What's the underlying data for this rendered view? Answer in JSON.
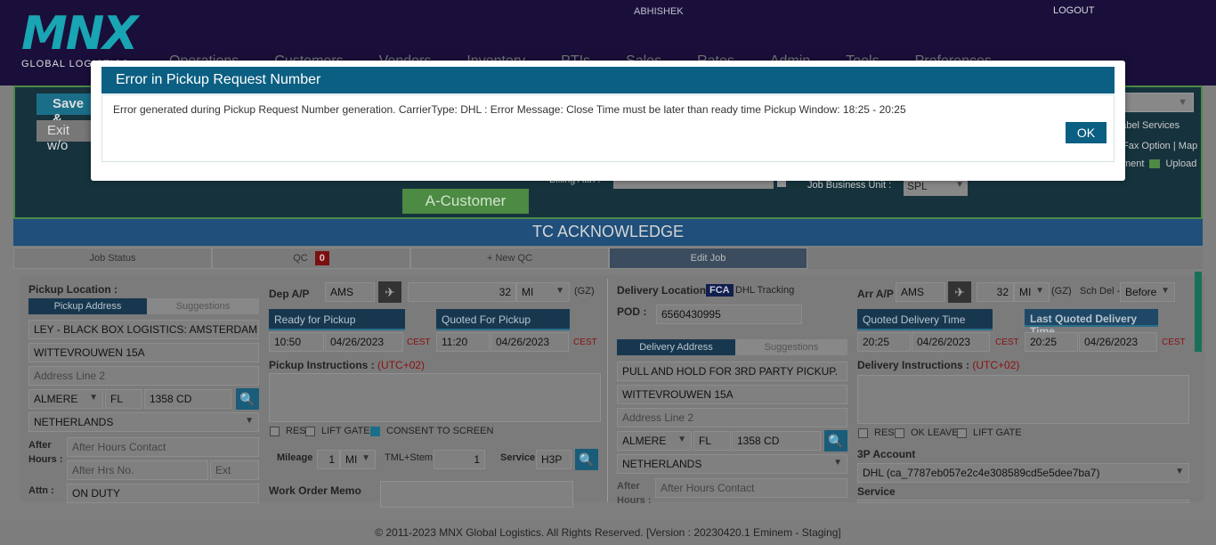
{
  "header": {
    "logo_text": "MNX",
    "logo_sub": "GLOBAL LOGISTICS",
    "user": "ABHISHEK",
    "logout": "LOGOUT",
    "nav": [
      "Operations",
      "Customers",
      "Vendors",
      "Inventory",
      "PTIs",
      "Sales",
      "Rates",
      "Admin",
      "Tools",
      "Preferences"
    ]
  },
  "top_panel": {
    "save_label": "Save &",
    "exit_label": "Exit w/o",
    "label_services": "Label Services",
    "fax_option": "Fax Option",
    "map": "Map",
    "document": "ment",
    "upload": "Upload",
    "billing_attn": "Billing Attn :",
    "job_business_unit_label": "Job Business Unit :",
    "job_business_unit_value": "SPL",
    "customer_button": "A-Customer"
  },
  "tc_title": "TC ACKNOWLEDGE",
  "tabs": {
    "job_status": "Job Status",
    "qc": "QC",
    "qc_count": "0",
    "new_qc": "+ New QC",
    "edit_job": "Edit Job"
  },
  "pickup": {
    "location_label": "Pickup Location :",
    "address_tab": "Pickup Address",
    "suggestions_tab": "Suggestions",
    "name": "LEY - BLACK BOX LOGISTICS: AMSTERDAM",
    "line1": "WITTEVROUWEN 15A",
    "line2_placeholder": "Address Line 2",
    "city": "ALMERE",
    "state": "FL",
    "zip": "1358 CD",
    "country": "NETHERLANDS",
    "after_hours_label": "After Hours :",
    "after_hours_contact_placeholder": "After Hours Contact",
    "after_hrs_no_placeholder": "After Hrs No.",
    "ext_placeholder": "Ext",
    "attn_label": "Attn :",
    "attn_value": "ON DUTY"
  },
  "dep": {
    "label": "Dep A/P",
    "airport": "AMS",
    "distance": "32",
    "unit": "MI",
    "gz": "(GZ)",
    "ready_label": "Ready for Pickup",
    "ready_time": "10:50",
    "ready_date": "04/26/2023",
    "tz": "CEST",
    "quoted_label": "Quoted For Pickup",
    "quoted_time": "11:20",
    "quoted_date": "04/26/2023",
    "instructions_label": "Pickup Instructions :",
    "utc": "(UTC+02)",
    "res": "RES",
    "lift_gate": "LIFT GATE",
    "consent": "CONSENT TO SCREEN",
    "mileage_label": "Mileage",
    "mileage": "1",
    "mileage_unit": "MI",
    "tml_label": "TML+Stem",
    "tml": "1",
    "service_label": "Service",
    "service": "H3P",
    "wom_label": "Work Order Memo"
  },
  "delivery": {
    "location_label": "Delivery Location :",
    "fca": "FCA",
    "dhl_tracking": "DHL Tracking",
    "pod_label": "POD :",
    "pod": "6560430995",
    "address_tab": "Delivery Address",
    "suggestions_tab": "Suggestions",
    "name": "PULL AND HOLD FOR 3RD PARTY PICKUP.",
    "line1": "WITTEVROUWEN 15A",
    "line2_placeholder": "Address Line 2",
    "city": "ALMERE",
    "state": "FL",
    "zip": "1358 CD",
    "country": "NETHERLANDS",
    "after_hours_label": "After Hours :",
    "after_hours_contact_placeholder": "After Hours Contact"
  },
  "arr": {
    "label": "Arr A/P",
    "airport": "AMS",
    "distance": "32",
    "unit": "MI",
    "gz": "(GZ)",
    "sch_del_label": "Sch Del -",
    "sch_del": "Before",
    "quoted_label": "Quoted Delivery Time",
    "quoted_time": "20:25",
    "quoted_date": "04/26/2023",
    "tz": "CEST",
    "last_label": "Last Quoted Delivery Time",
    "last_time": "20:25",
    "last_date": "04/26/2023",
    "instructions_label": "Delivery Instructions :",
    "utc": "(UTC+02)",
    "res": "RES",
    "ok_leave": "OK LEAVE",
    "lift_gate": "LIFT GATE",
    "account_label": "3P Account",
    "account": "DHL (ca_7787eb057e2c4e308589cd5e5dee7ba7)",
    "service_label": "Service"
  },
  "footer": "© 2011-2023 MNX Global Logistics. All Rights Reserved. [Version : 20230420.1 Eminem - Staging]",
  "modal": {
    "title": "Error in Pickup Request Number",
    "message": "Error generated during Pickup Request Number generation. CarrierType: DHL : Error Message: Close Time must be later than ready time Pickup Window: 18:25 - 20:25",
    "ok": "OK"
  }
}
